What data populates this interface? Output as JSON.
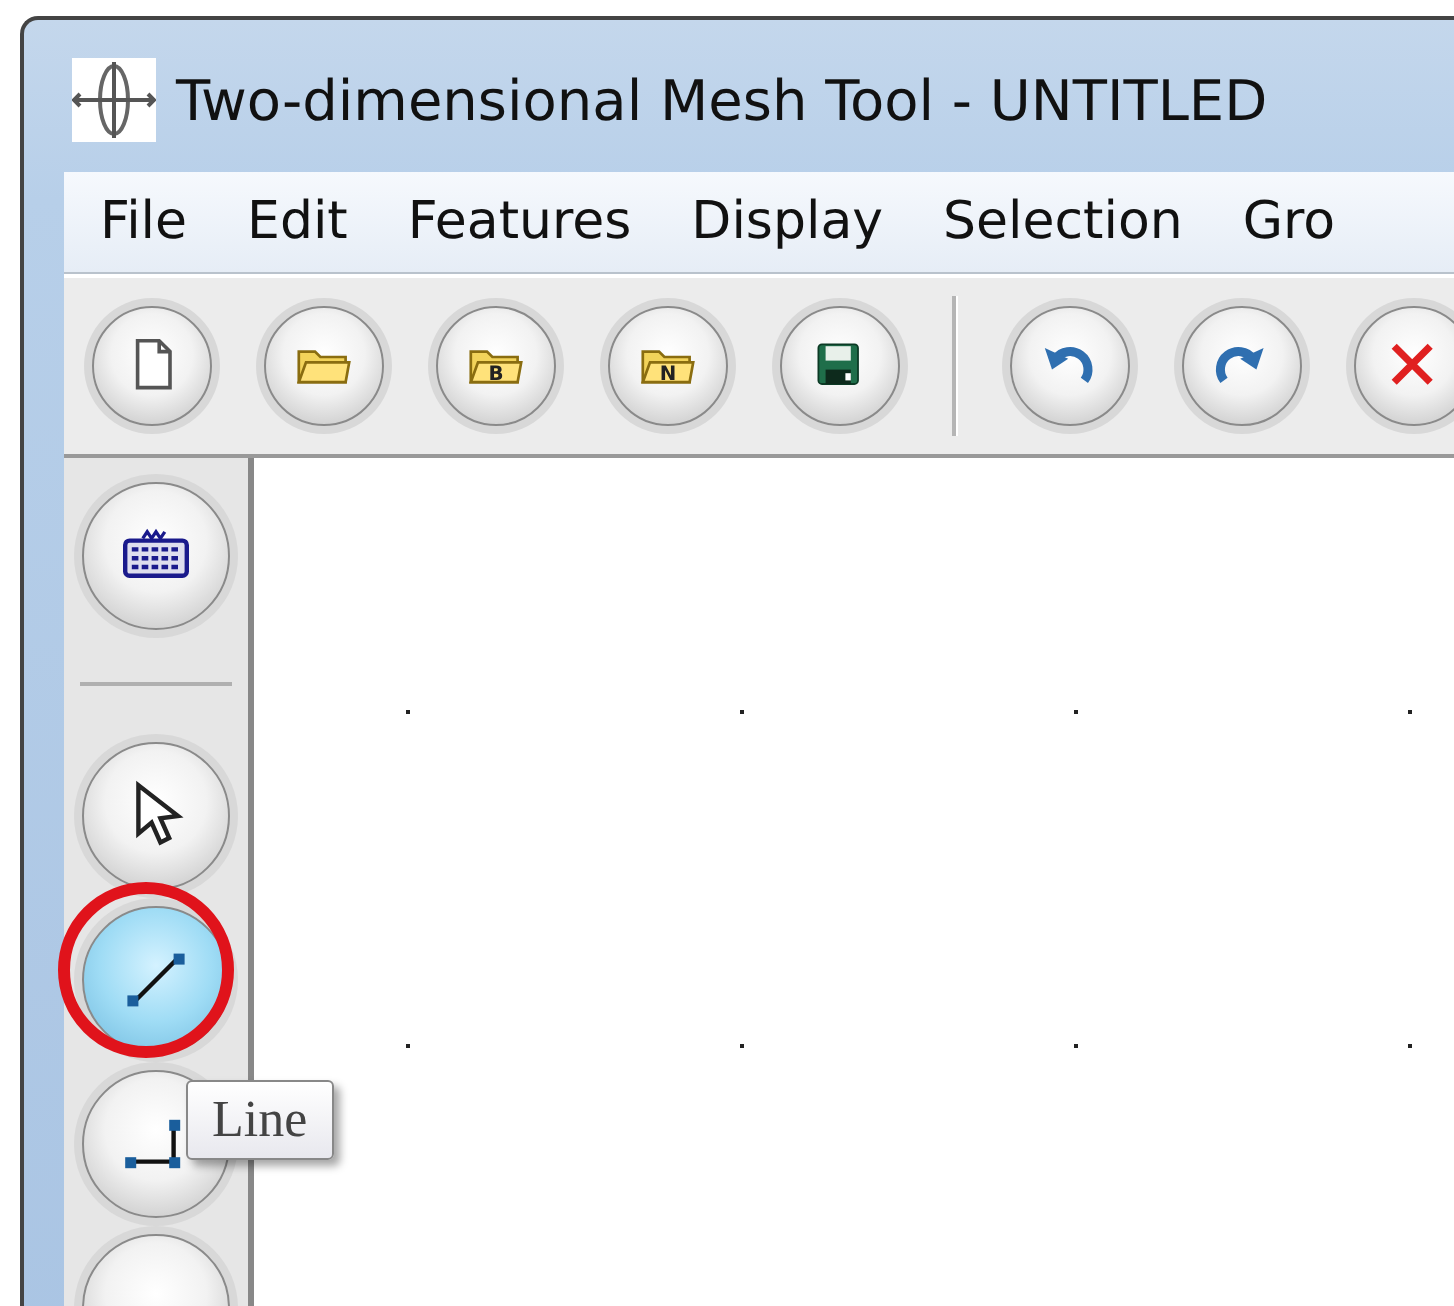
{
  "window": {
    "title": "Two-dimensional Mesh Tool - UNTITLED"
  },
  "menu": [
    "File",
    "Edit",
    "Features",
    "Display",
    "Selection",
    "Gro"
  ],
  "toolbar": [
    {
      "kind": "new"
    },
    {
      "kind": "open"
    },
    {
      "kind": "open-lettered",
      "letter": "B"
    },
    {
      "kind": "open-lettered",
      "letter": "N"
    },
    {
      "kind": "save"
    },
    {
      "kind": "separator"
    },
    {
      "kind": "undo"
    },
    {
      "kind": "redo"
    },
    {
      "kind": "delete"
    }
  ],
  "tools": [
    {
      "kind": "keyboard",
      "selected": false
    },
    {
      "kind": "separator"
    },
    {
      "kind": "select",
      "selected": false
    },
    {
      "kind": "line",
      "selected": true,
      "highlighted": true
    },
    {
      "kind": "polyline",
      "selected": false
    },
    {
      "kind": "blank",
      "selected": false
    }
  ],
  "tooltip": {
    "text": "Line"
  }
}
